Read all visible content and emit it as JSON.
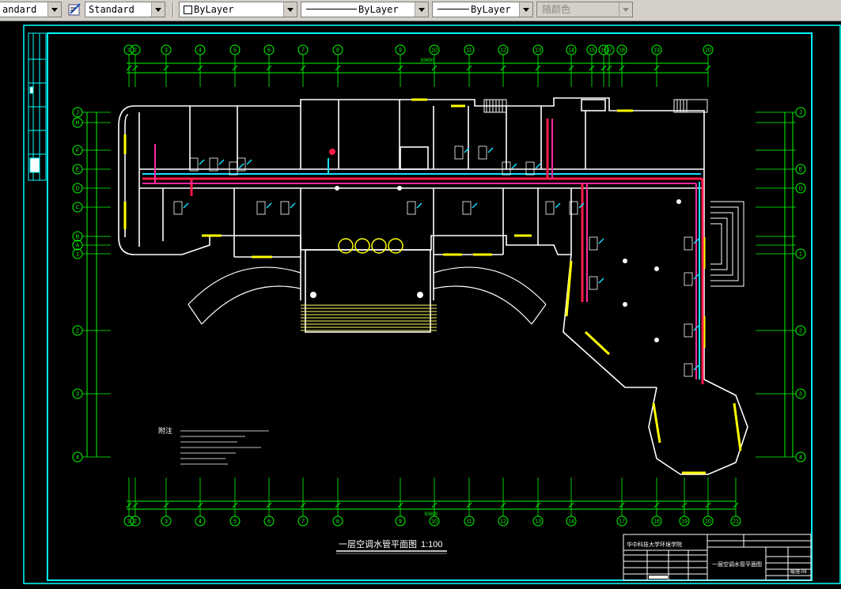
{
  "toolbar": {
    "text_style": "andard",
    "dim_style": "Standard",
    "layer": "ByLayer",
    "linetype": "ByLayer",
    "lineweight": "ByLayer",
    "color": "随颜色"
  },
  "drawing": {
    "top_total_dim": "83600",
    "bottom_total_dim": "83600",
    "plan_title": "一层空调水管平面图",
    "scale": "1:100",
    "notes_title": "附注",
    "block_title": "一层空调水管平面图",
    "sheet_no": "暖施-06",
    "school_name": "华中科技大学环境学院",
    "grid_top": [
      "1",
      "2",
      "3",
      "4",
      "5",
      "6",
      "7",
      "8",
      "9",
      "10",
      "11",
      "12",
      "13",
      "14",
      "15",
      "16",
      "17",
      "18",
      "19",
      "20"
    ],
    "grid_bottom": [
      "1",
      "2",
      "3",
      "4",
      "5",
      "6",
      "7",
      "8",
      "9",
      "10",
      "11",
      "12",
      "13",
      "14",
      "17",
      "18",
      "19",
      "20",
      "21"
    ],
    "grid_left": [
      "J",
      "H",
      "F",
      "E",
      "D",
      "C",
      "B",
      "A",
      "1",
      "2",
      "3",
      "4"
    ]
  },
  "colors": {
    "supply_pipe": "#ff1a4a",
    "return_pipe": "#ff2aa0",
    "condensate_pipe": "#14e0ff",
    "walls": "#ffffff",
    "windows": "#ffff00",
    "frame": "#00ffff",
    "grid": "#00ff00"
  }
}
